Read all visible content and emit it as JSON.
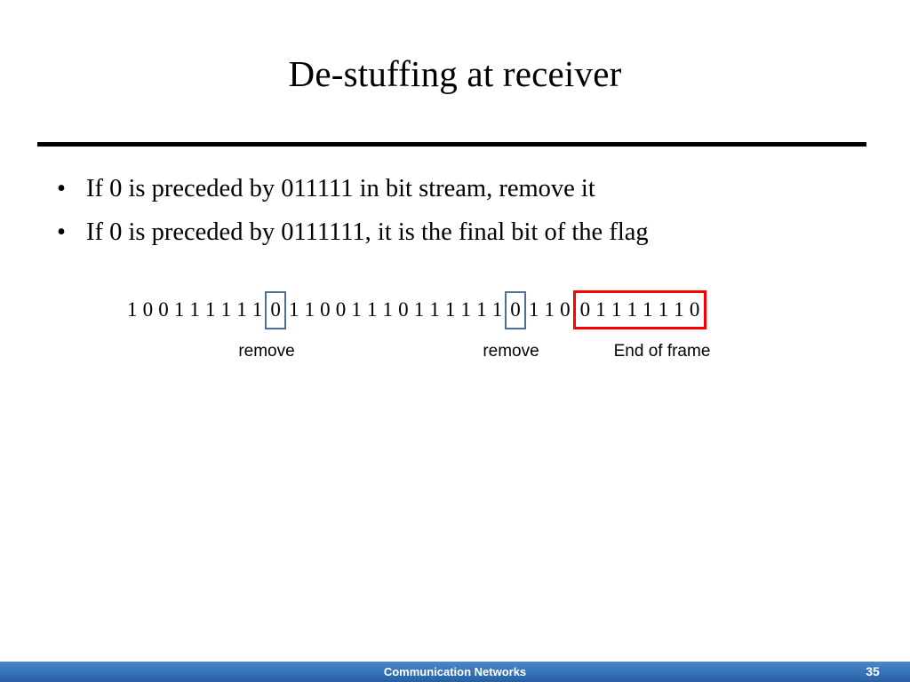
{
  "slide": {
    "title": "De-stuffing at receiver",
    "bullets": [
      {
        "marker": "•",
        "text": "If 0 is preceded by 011111 in bit stream, remove it"
      },
      {
        "marker": "•",
        "text": "If 0 is preceded by 0111111, it is the final bit of the flag"
      }
    ],
    "bitstream": {
      "segments": [
        {
          "id": "prefix",
          "style": "plain",
          "bits": "100111111"
        },
        {
          "id": "stuffed-bit-1",
          "style": "box-blue",
          "bits": "0"
        },
        {
          "id": "middle",
          "style": "plain",
          "bits": "11001110111111"
        },
        {
          "id": "stuffed-bit-2",
          "style": "box-blue",
          "bits": "0"
        },
        {
          "id": "tail",
          "style": "plain",
          "bits": "110"
        },
        {
          "id": "end-flag",
          "style": "box-red",
          "bits": "01111110"
        }
      ],
      "callouts": [
        {
          "id": "remove-1",
          "text": "remove"
        },
        {
          "id": "remove-2",
          "text": "remove"
        },
        {
          "id": "end-of-frame",
          "text": "End of frame"
        }
      ],
      "colors": {
        "stuffed_bit_box": "#4a7099",
        "end_flag_box": "#ff0000"
      }
    },
    "footer": {
      "course": "Communication Networks",
      "slide_number": "35",
      "bar_color_top": "#4a86c8",
      "bar_color_bottom": "#2b5f9e"
    }
  }
}
